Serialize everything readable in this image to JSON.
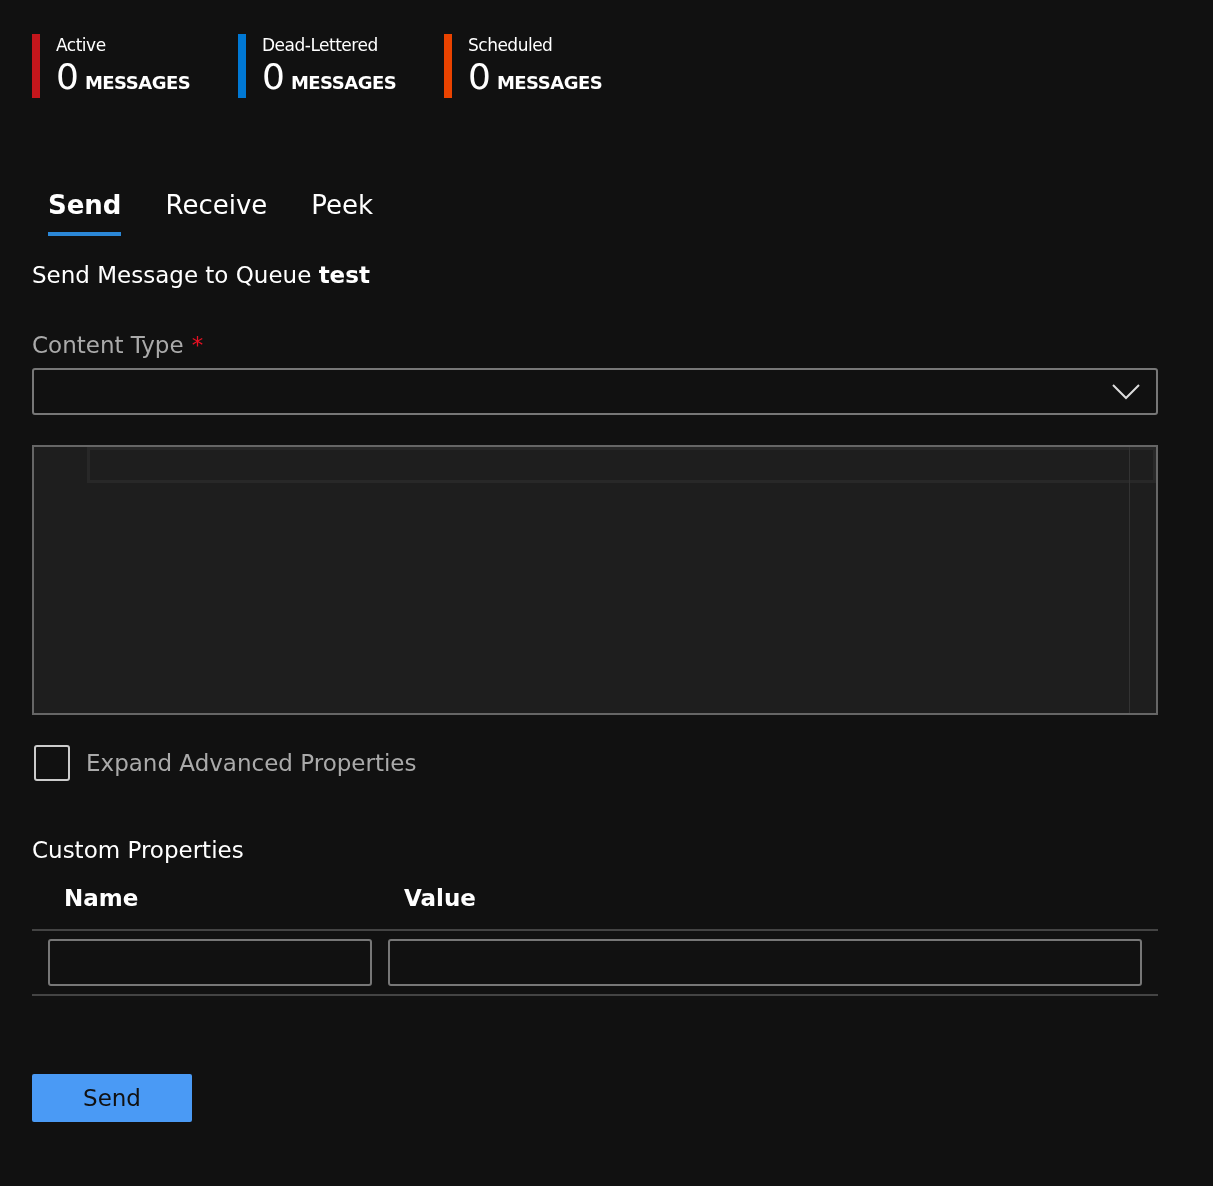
{
  "metrics": [
    {
      "label": "Active",
      "count": "0",
      "unit": "MESSAGES",
      "color": "#c4161c"
    },
    {
      "label": "Dead-Lettered",
      "count": "0",
      "unit": "MESSAGES",
      "color": "#0078d4"
    },
    {
      "label": "Scheduled",
      "count": "0",
      "unit": "MESSAGES",
      "color": "#ea4300"
    }
  ],
  "tabs": [
    {
      "label": "Send",
      "selected": true
    },
    {
      "label": "Receive",
      "selected": false
    },
    {
      "label": "Peek",
      "selected": false
    }
  ],
  "heading": "Send Message to Queue **test**",
  "content_type": {
    "label": "Content Type",
    "required_mark": "*"
  },
  "advanced": {
    "label": "Expand Advanced Properties",
    "checked": false
  },
  "custom_properties": {
    "title": "Custom Properties",
    "columns": [
      "Name",
      "Value"
    ]
  },
  "send_button": "Send"
}
